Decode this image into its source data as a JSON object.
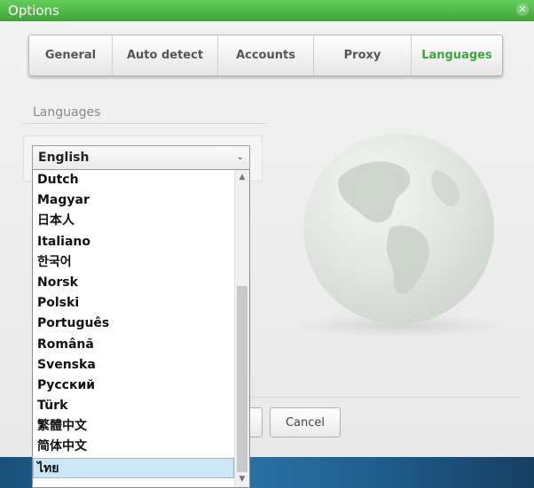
{
  "window": {
    "title": "Options"
  },
  "tabs": [
    {
      "label": "General",
      "active": false
    },
    {
      "label": "Auto detect",
      "active": false
    },
    {
      "label": "Accounts",
      "active": false
    },
    {
      "label": "Proxy",
      "active": false
    },
    {
      "label": "Languages",
      "active": true
    }
  ],
  "section": {
    "title": "Languages"
  },
  "language_select": {
    "selected": "English",
    "options": [
      "Dutch",
      "Magyar",
      "日本人",
      "Italiano",
      "한국어",
      "Norsk",
      "Polski",
      "Português",
      "Română",
      "Svenska",
      "Русский",
      "Türk",
      "繁體中文",
      "简体中文",
      "ไทย"
    ],
    "highlighted": "ไทย"
  },
  "buttons": {
    "cancel": "Cancel"
  },
  "colors": {
    "accent": "#3aa836",
    "titlebar": "#4fb947",
    "selection": "#cce8f7"
  },
  "icons": {
    "close": "close-icon",
    "chevron": "chevron-down-icon",
    "scroll_up": "scroll-up-icon",
    "scroll_down": "scroll-down-icon"
  }
}
